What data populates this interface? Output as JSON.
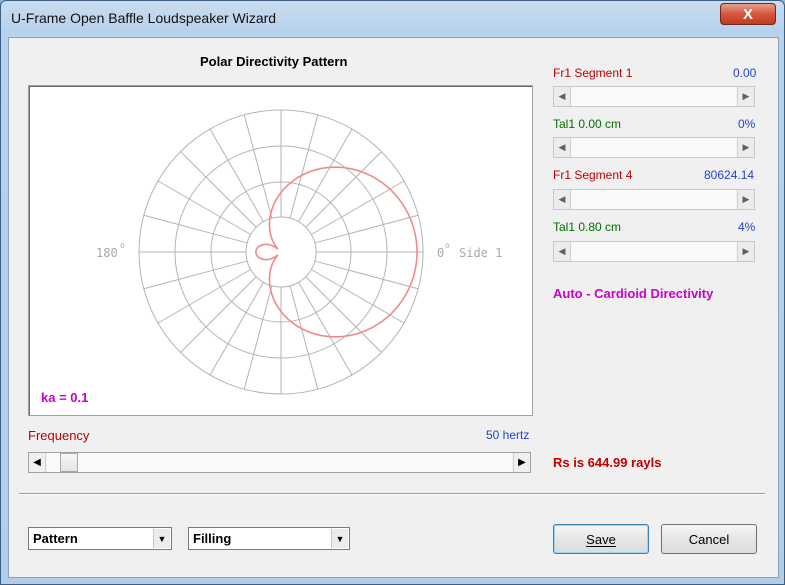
{
  "window": {
    "title": "U-Frame Open Baffle Loudspeaker Wizard",
    "close_glyph": "X"
  },
  "plot": {
    "heading": "Polar Directivity Pattern",
    "left_axis_label": "180",
    "right_axis_label": "0",
    "right_axis_suffix": "Side 1",
    "ka_label": "ka = 0.1",
    "grid_color": "#b4b4b4",
    "curve_color": "#f08a8a"
  },
  "frequency": {
    "label": "Frequency",
    "value": "50 hertz",
    "level": 0.03
  },
  "controls": [
    {
      "label": "Fr1  Segment 1",
      "value": "0.00",
      "label_color": "#c00000",
      "level": 0.0
    },
    {
      "label": "Tal1  0.00 cm",
      "value": "0%",
      "label_color": "#007000",
      "level": 0.0
    },
    {
      "label": "Fr1  Segment 4",
      "value": "80624.14",
      "label_color": "#c00000",
      "level": 0.0
    },
    {
      "label": "Tal1  0.80 cm",
      "value": "4%",
      "label_color": "#007000",
      "level": 0.0
    }
  ],
  "mode_text": "Auto - Cardioid Directivity",
  "rs_text": "Rs is 644.99 rayls",
  "combos": [
    {
      "value": "Pattern"
    },
    {
      "value": "Filling"
    }
  ],
  "buttons": {
    "save": "Save",
    "cancel": "Cancel"
  }
}
